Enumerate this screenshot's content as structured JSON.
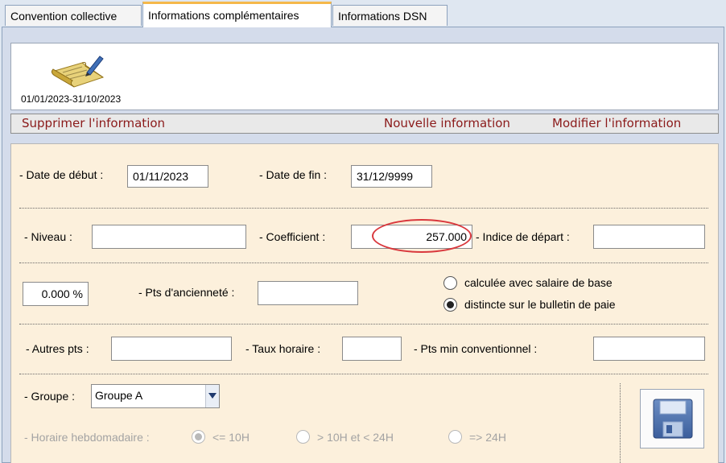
{
  "tabs": [
    {
      "label": "Convention collective",
      "active": false
    },
    {
      "label": "Informations complémentaires",
      "active": true
    },
    {
      "label": "Informations DSN",
      "active": false
    }
  ],
  "info_period": "01/01/2023-31/10/2023",
  "actions": {
    "delete": "Supprimer l'information",
    "new": "Nouvelle information",
    "edit": "Modifier l'information"
  },
  "form": {
    "date_debut_label": "- Date de début :",
    "date_debut_value": "01/11/2023",
    "date_fin_label": "- Date de fin :",
    "date_fin_value": "31/12/9999",
    "niveau_label": "- Niveau :",
    "niveau_value": "",
    "coefficient_label": "- Coefficient  :",
    "coefficient_value": "257.000",
    "indice_label": "- Indice de départ :",
    "indice_value": "",
    "percent_value": "0.000 %",
    "pts_anciennete_label": "- Pts d'ancienneté :",
    "pts_anciennete_value": "",
    "radio_calc_label": "calculée avec salaire de base",
    "radio_distinct_label": "distincte sur le bulletin de paie",
    "autres_pts_label": "- Autres pts :",
    "autres_pts_value": "",
    "taux_horaire_label": "- Taux horaire :",
    "taux_horaire_value": "",
    "pts_min_label": "- Pts min conventionnel  :",
    "pts_min_value": "",
    "groupe_label": "- Groupe :",
    "groupe_value": "Groupe A",
    "horaire_label": "- Horaire hebdomadaire :",
    "horaire_opt1": "<= 10H",
    "horaire_opt2": "> 10H et < 24H",
    "horaire_opt3": "=> 24H"
  },
  "colors": {
    "action_text": "#8b1a1a",
    "panel_bg": "#fcf0dc",
    "highlight": "#d9383d",
    "active_tab_accent": "#f5b84a"
  },
  "icons": {
    "info_item": "notebook-pen-icon",
    "save": "floppy-disk-icon",
    "dropdown": "chevron-down-icon"
  }
}
